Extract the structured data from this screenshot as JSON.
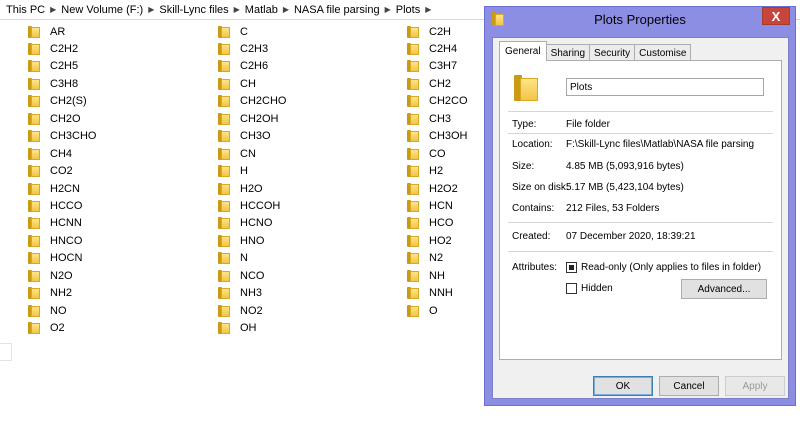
{
  "breadcrumb": [
    "This PC",
    "New Volume (F:)",
    "Skill-Lync files",
    "Matlab",
    "NASA file parsing",
    "Plots"
  ],
  "folders": {
    "col1": [
      "AR",
      "C2H2",
      "C2H5",
      "C3H8",
      "CH2(S)",
      "CH2O",
      "CH3CHO",
      "CH4",
      "CO2",
      "H2CN",
      "HCCO",
      "HCNN",
      "HNCO",
      "HOCN",
      "N2O",
      "NH2",
      "NO",
      "O2"
    ],
    "col2": [
      "C",
      "C2H3",
      "C2H6",
      "CH",
      "CH2CHO",
      "CH2OH",
      "CH3O",
      "CN",
      "H",
      "H2O",
      "HCCOH",
      "HCNO",
      "HNO",
      "N",
      "NCO",
      "NH3",
      "NO2",
      "OH"
    ],
    "col3": [
      "C2H",
      "C2H4",
      "C3H7",
      "CH2",
      "CH2CO",
      "CH3",
      "CH3OH",
      "CO",
      "H2",
      "H2O2",
      "HCN",
      "HCO",
      "HO2",
      "N2",
      "NH",
      "NNH",
      "O"
    ]
  },
  "dialog": {
    "title": "Plots Properties",
    "close_label": "X",
    "tabs": [
      "General",
      "Sharing",
      "Security",
      "Customise"
    ],
    "active_tab": "General",
    "name_value": "Plots",
    "type_label": "Type:",
    "type_value": "File folder",
    "location_label": "Location:",
    "location_value": "F:\\Skill-Lync files\\Matlab\\NASA file parsing",
    "size_label": "Size:",
    "size_value": "4.85 MB (5,093,916 bytes)",
    "size_on_disk_label": "Size on disk:",
    "size_on_disk_value": "5.17 MB (5,423,104 bytes)",
    "contains_label": "Contains:",
    "contains_value": "212 Files, 53 Folders",
    "created_label": "Created:",
    "created_value": "07 December 2020, 18:39:21",
    "attributes_label": "Attributes:",
    "readonly_label": "Read-only (Only applies to files in folder)",
    "hidden_label": "Hidden",
    "advanced_label": "Advanced...",
    "ok_label": "OK",
    "cancel_label": "Cancel",
    "apply_label": "Apply"
  },
  "colors": {
    "dialog_frame": "#8c8ee3",
    "close_button": "#c7453a",
    "folder_yellow": "#f2c548"
  }
}
